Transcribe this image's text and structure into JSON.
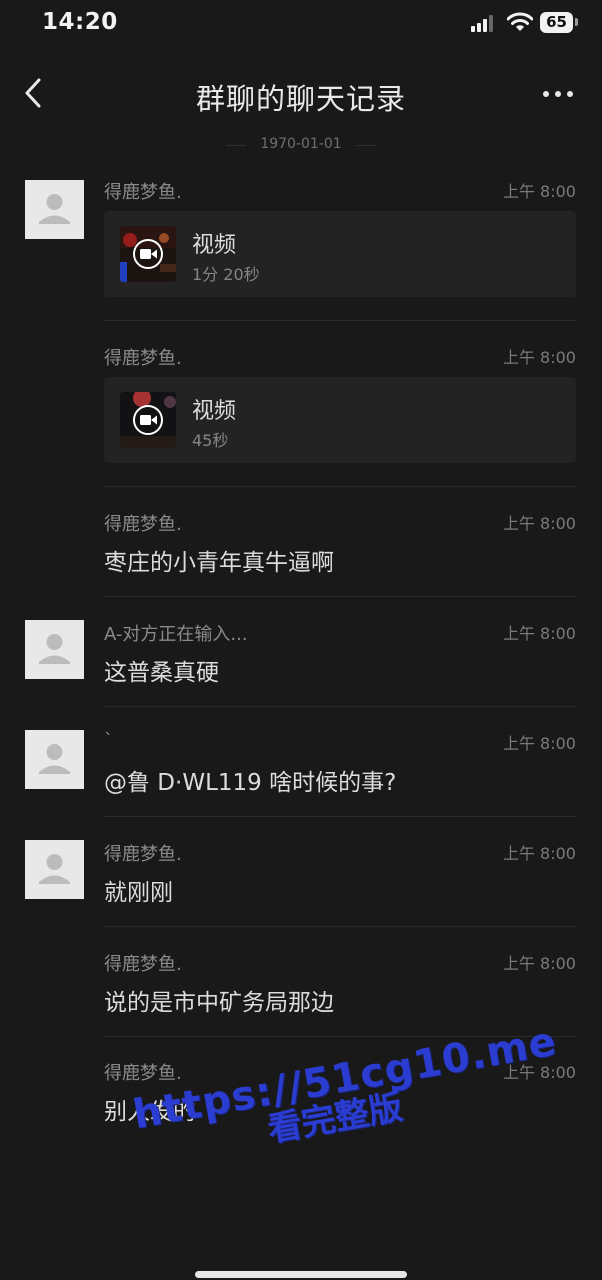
{
  "status_bar": {
    "time": "14:20",
    "battery": "65"
  },
  "nav": {
    "title": "群聊的聊天记录"
  },
  "date_divider": "1970-01-01",
  "messages": [
    {
      "sender": "得鹿梦鱼.",
      "time": "上午 8:00",
      "type": "video",
      "label": "视频",
      "duration": "1分 20秒"
    },
    {
      "sender": "得鹿梦鱼.",
      "time": "上午 8:00",
      "type": "video",
      "label": "视频",
      "duration": "45秒"
    },
    {
      "sender": "得鹿梦鱼.",
      "time": "上午 8:00",
      "type": "text",
      "text": "枣庄的小青年真牛逼啊"
    },
    {
      "sender": "A-对方正在输入...",
      "time": "上午 8:00",
      "type": "text",
      "text": "这普桑真硬"
    },
    {
      "sender": "`",
      "time": "上午 8:00",
      "type": "text",
      "text": "@鲁 D·WL119 啥时候的事?"
    },
    {
      "sender": "得鹿梦鱼.",
      "time": "上午 8:00",
      "type": "text",
      "text": "就刚刚"
    },
    {
      "sender": "得鹿梦鱼.",
      "time": "上午 8:00",
      "type": "text",
      "text": "说的是市中矿务局那边"
    },
    {
      "sender": "得鹿梦鱼.",
      "time": "上午 8:00",
      "type": "text",
      "text": "别人发的"
    }
  ],
  "watermark": {
    "url": "https://51cg10.me",
    "text": "看完整版"
  }
}
